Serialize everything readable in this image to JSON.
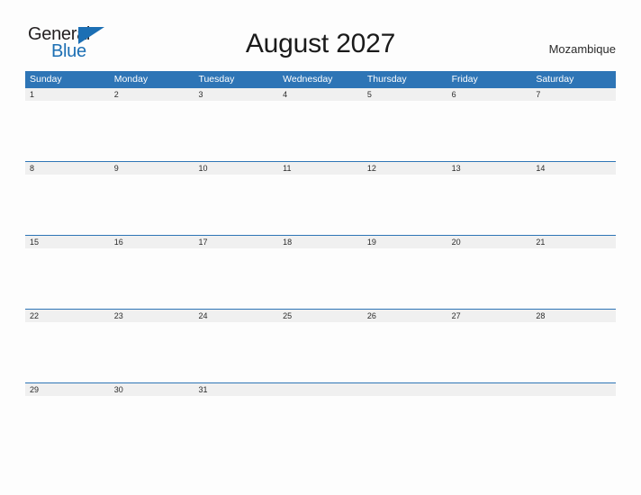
{
  "brand": {
    "name_part1": "General",
    "name_part2": "Blue",
    "triangle_icon": "triangle-icon",
    "accent_color": "#1c6fb4"
  },
  "header": {
    "title": "August 2027",
    "month": "August",
    "year": "2027",
    "country": "Mozambique"
  },
  "colors": {
    "header_band": "#2e75b6",
    "date_band": "#f0f0f0",
    "page_background": "#fdfdfd",
    "text": "#2b2b2b",
    "header_text": "#ffffff"
  },
  "calendar": {
    "weekdays": [
      "Sunday",
      "Monday",
      "Tuesday",
      "Wednesday",
      "Thursday",
      "Friday",
      "Saturday"
    ],
    "weeks": [
      {
        "days": [
          {
            "date": "1"
          },
          {
            "date": "2"
          },
          {
            "date": "3"
          },
          {
            "date": "4"
          },
          {
            "date": "5"
          },
          {
            "date": "6"
          },
          {
            "date": "7"
          }
        ]
      },
      {
        "days": [
          {
            "date": "8"
          },
          {
            "date": "9"
          },
          {
            "date": "10"
          },
          {
            "date": "11"
          },
          {
            "date": "12"
          },
          {
            "date": "13"
          },
          {
            "date": "14"
          }
        ]
      },
      {
        "days": [
          {
            "date": "15"
          },
          {
            "date": "16"
          },
          {
            "date": "17"
          },
          {
            "date": "18"
          },
          {
            "date": "19"
          },
          {
            "date": "20"
          },
          {
            "date": "21"
          }
        ]
      },
      {
        "days": [
          {
            "date": "22"
          },
          {
            "date": "23"
          },
          {
            "date": "24"
          },
          {
            "date": "25"
          },
          {
            "date": "26"
          },
          {
            "date": "27"
          },
          {
            "date": "28"
          }
        ]
      },
      {
        "days": [
          {
            "date": "29"
          },
          {
            "date": "30"
          },
          {
            "date": "31"
          },
          {
            "date": ""
          },
          {
            "date": ""
          },
          {
            "date": ""
          },
          {
            "date": ""
          }
        ]
      }
    ]
  }
}
